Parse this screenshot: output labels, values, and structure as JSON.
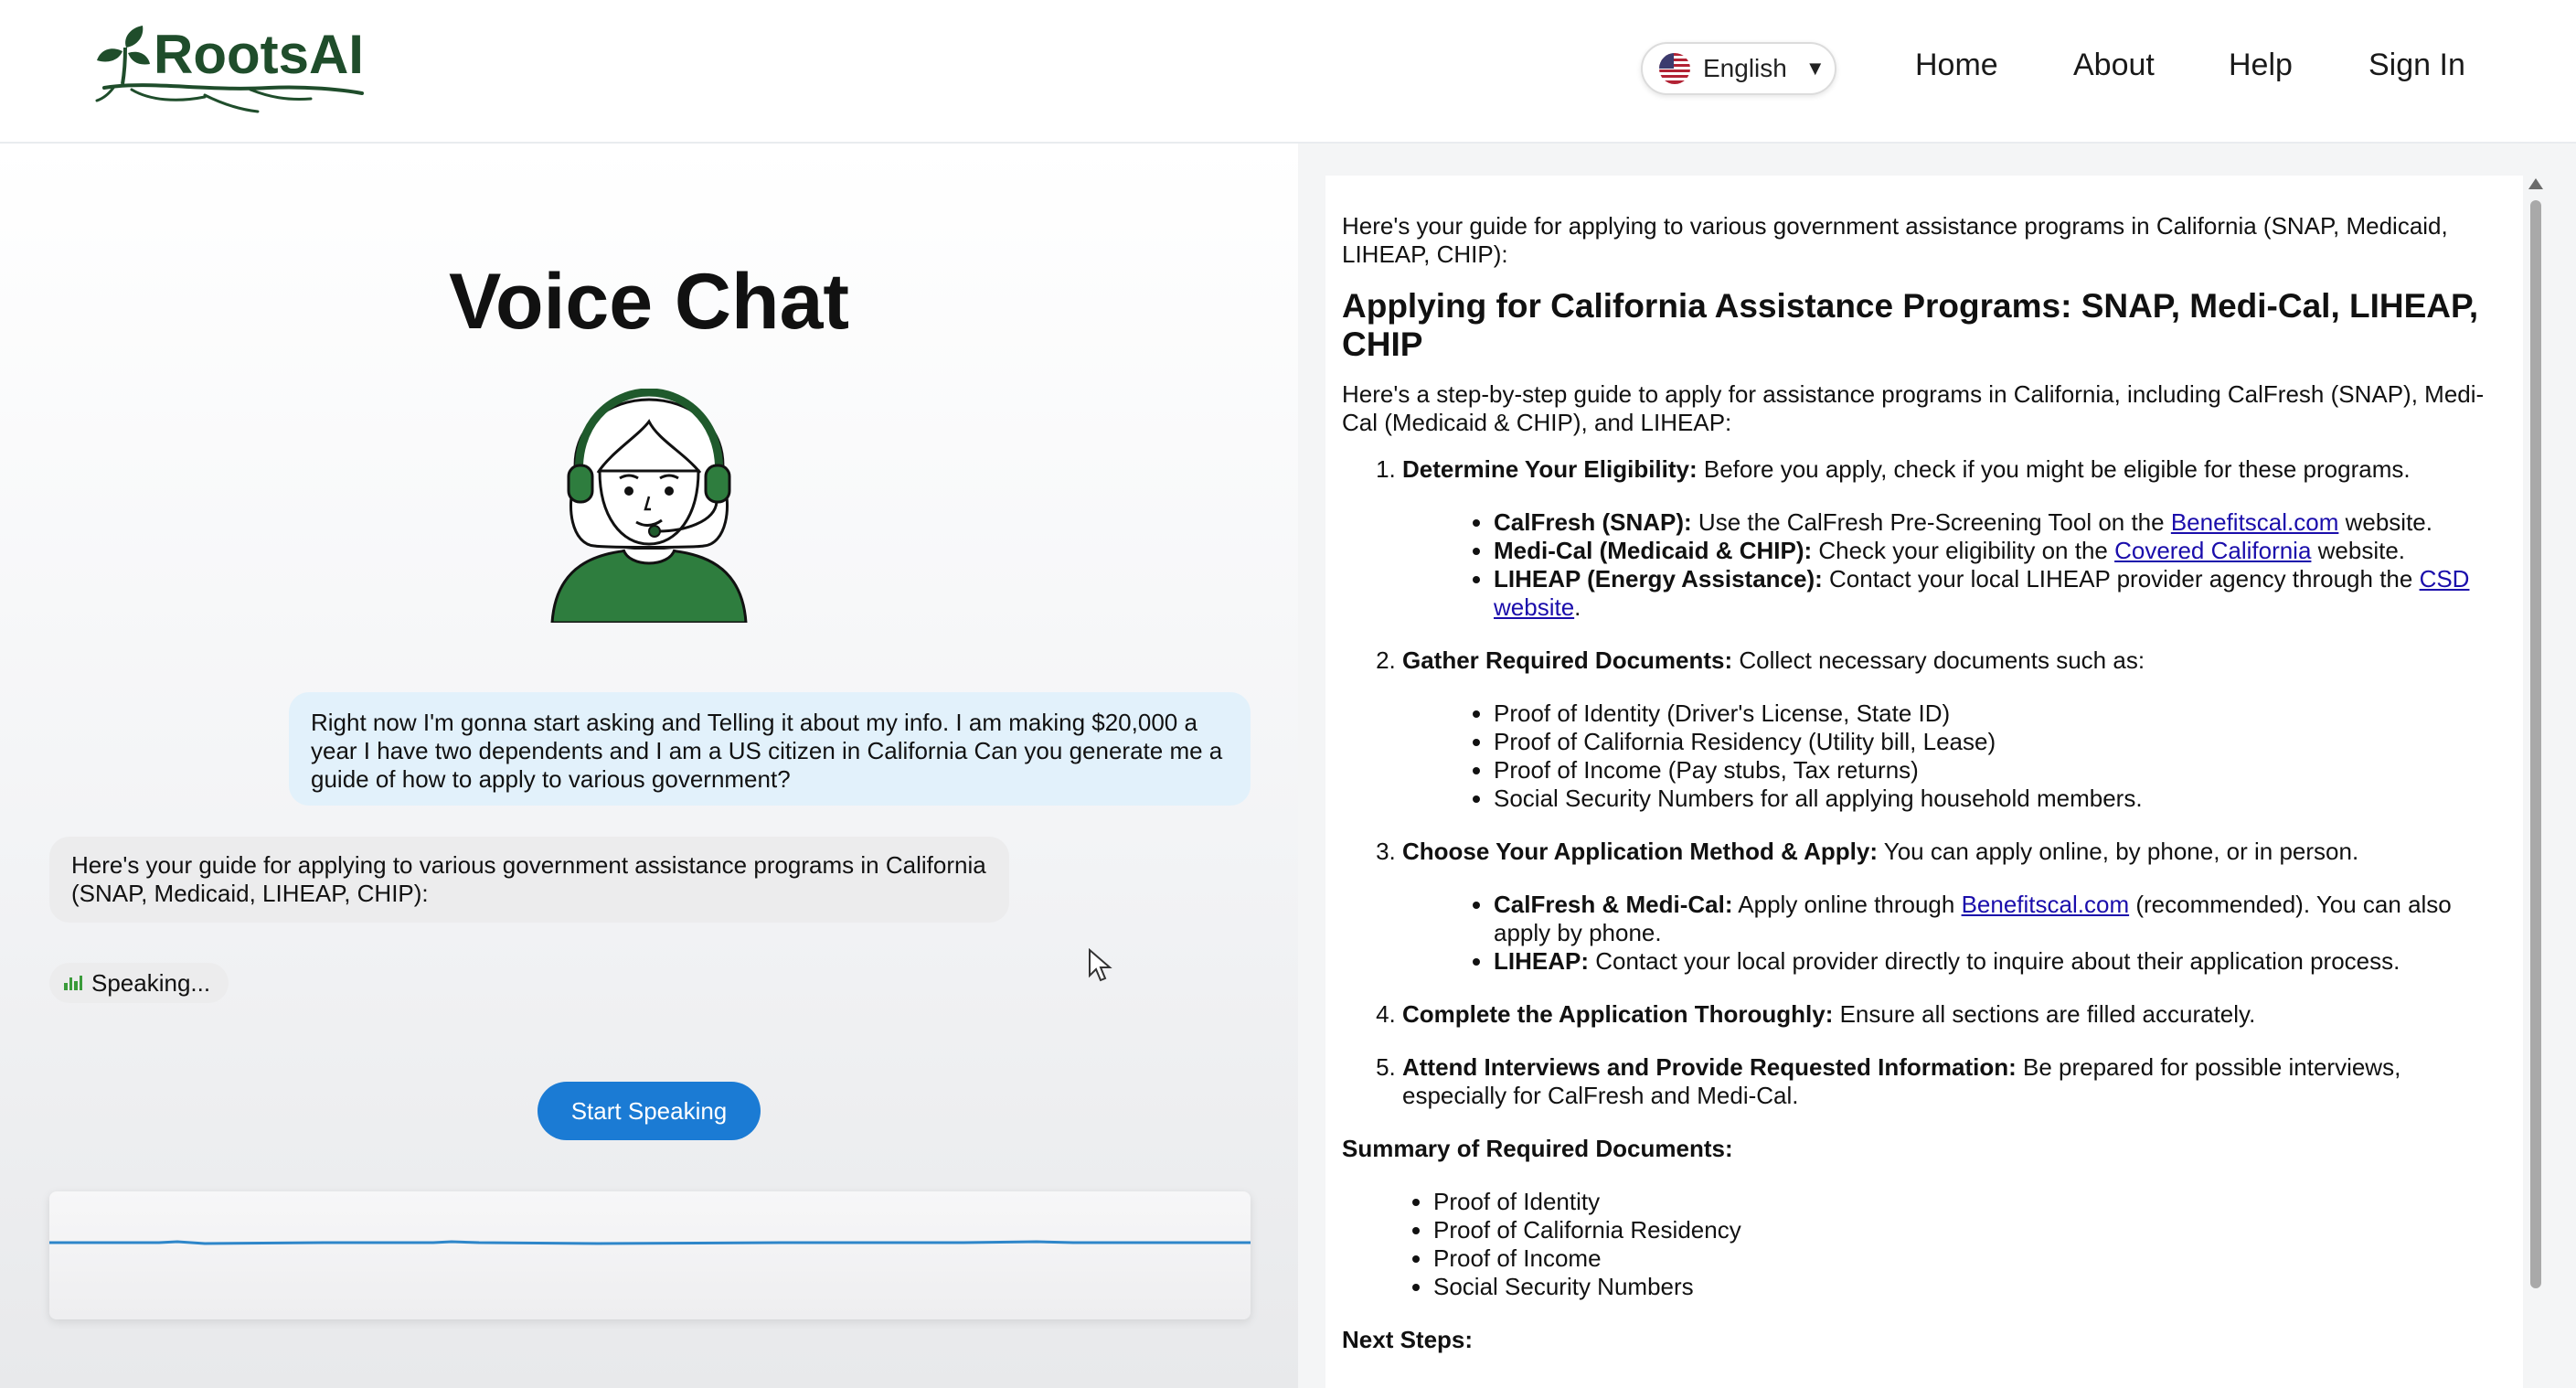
{
  "brand": {
    "name": "RootsAI"
  },
  "header": {
    "language": "English",
    "nav": [
      "Home",
      "About",
      "Help",
      "Sign In"
    ]
  },
  "chat": {
    "title": "Voice Chat",
    "user_message": "Right now I'm gonna start asking and Telling it about my info. I am making $20,000 a year I have two dependents and I am a US citizen in California Can you generate me a guide of how to apply to various government?",
    "bot_message": "Here's your guide for applying to various government assistance programs in California (SNAP, Medicaid, LIHEAP, CHIP):",
    "status": "Speaking...",
    "start_button": "Start Speaking"
  },
  "guide": {
    "intro": "Here's your guide for applying to various government assistance programs in California (SNAP, Medicaid, LIHEAP, CHIP):",
    "heading": "Applying for California Assistance Programs: SNAP, Medi-Cal, LIHEAP, CHIP",
    "lead": "Here's a step-by-step guide to apply for assistance programs in California, including CalFresh (SNAP), Medi-Cal (Medicaid & CHIP), and LIHEAP:",
    "step1": {
      "title": "Determine Your Eligibility:",
      "text": " Before you apply, check if you might be eligible for these programs.",
      "items": [
        {
          "label": "CalFresh (SNAP):",
          "pre": " Use the CalFresh Pre-Screening Tool on the ",
          "link": "Benefitscal.com",
          "post": " website."
        },
        {
          "label": "Medi-Cal (Medicaid & CHIP):",
          "pre": " Check your eligibility on the ",
          "link": "Covered California",
          "post": " website."
        },
        {
          "label": "LIHEAP (Energy Assistance):",
          "pre": " Contact your local LIHEAP provider agency through the ",
          "link": "CSD website",
          "post": "."
        }
      ]
    },
    "step2": {
      "title": "Gather Required Documents:",
      "text": " Collect necessary documents such as:",
      "items": [
        "Proof of Identity (Driver's License, State ID)",
        "Proof of California Residency (Utility bill, Lease)",
        "Proof of Income (Pay stubs, Tax returns)",
        "Social Security Numbers for all applying household members."
      ]
    },
    "step3": {
      "title": "Choose Your Application Method & Apply:",
      "text": " You can apply online, by phone, or in person.",
      "items": [
        {
          "label": "CalFresh & Medi-Cal:",
          "pre": " Apply online through ",
          "link": "Benefitscal.com",
          "post": " (recommended). You can also apply by phone."
        },
        {
          "label": "LIHEAP:",
          "pre": " Contact your local provider directly to inquire about their application process.",
          "link": "",
          "post": ""
        }
      ]
    },
    "step4": {
      "title": "Complete the Application Thoroughly:",
      "text": " Ensure all sections are filled accurately."
    },
    "step5": {
      "title": "Attend Interviews and Provide Requested Information:",
      "text": " Be prepared for possible interviews, especially for CalFresh and Medi-Cal."
    },
    "summary_heading": "Summary of Required Documents:",
    "summary_items": [
      "Proof of Identity",
      "Proof of California Residency",
      "Proof of Income",
      "Social Security Numbers"
    ],
    "next_heading": "Next Steps:"
  }
}
